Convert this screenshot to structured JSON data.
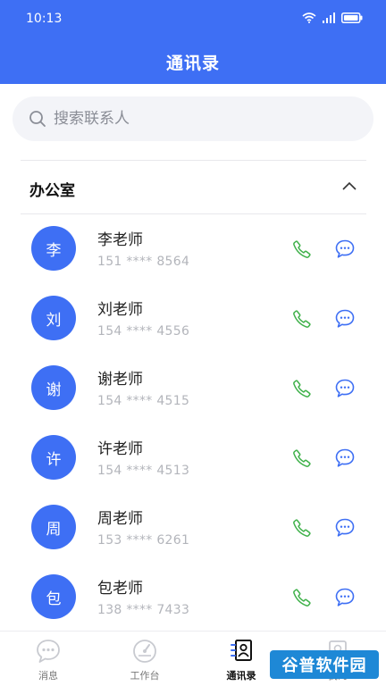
{
  "status_bar": {
    "time": "10:13"
  },
  "header": {
    "title": "通讯录"
  },
  "search": {
    "placeholder": "搜索联系人"
  },
  "group": {
    "title": "办公室"
  },
  "contacts": [
    {
      "avatar": "李",
      "name": "李老师",
      "phone": "151 **** 8564"
    },
    {
      "avatar": "刘",
      "name": "刘老师",
      "phone": "154 **** 4556"
    },
    {
      "avatar": "谢",
      "name": "谢老师",
      "phone": "154 **** 4515"
    },
    {
      "avatar": "许",
      "name": "许老师",
      "phone": "154 **** 4513"
    },
    {
      "avatar": "周",
      "name": "周老师",
      "phone": "153 **** 6261"
    },
    {
      "avatar": "包",
      "name": "包老师",
      "phone": "138 **** 7433"
    }
  ],
  "tabs": [
    {
      "label": "消息",
      "icon": "message-icon"
    },
    {
      "label": "工作台",
      "icon": "dashboard-icon"
    },
    {
      "label": "通讯录",
      "icon": "contacts-icon",
      "active": true
    },
    {
      "label": "我的",
      "icon": "profile-icon"
    }
  ],
  "watermark": "谷普软件园",
  "colors": {
    "primary": "#3e6ff4",
    "call": "#3fb14a",
    "message": "#3e6ff4"
  }
}
